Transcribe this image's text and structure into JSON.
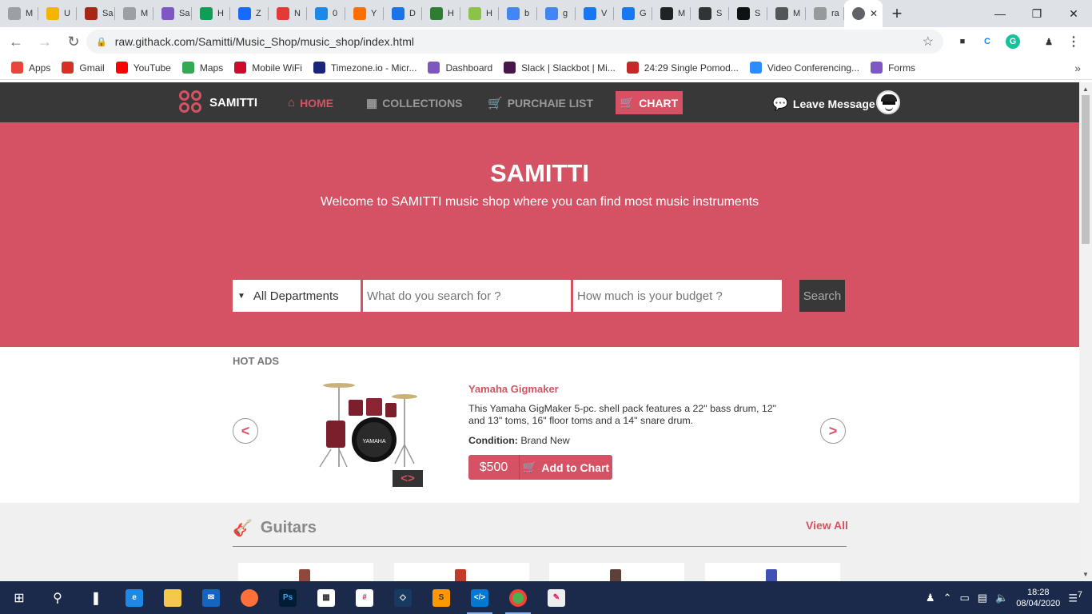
{
  "browser": {
    "tabs": [
      {
        "label": "M",
        "color": "#9aa0a6"
      },
      {
        "label": "U",
        "color": "#f4b400"
      },
      {
        "label": "Sa",
        "color": "#a52714"
      },
      {
        "label": "M",
        "color": "#9aa0a6"
      },
      {
        "label": "Sa",
        "color": "#7e57c2"
      },
      {
        "label": "H",
        "color": "#0f9d58"
      },
      {
        "label": "Z",
        "color": "#1769ff"
      },
      {
        "label": "N",
        "color": "#e53935"
      },
      {
        "label": "0",
        "color": "#1e88e5"
      },
      {
        "label": "Y",
        "color": "#ff6f00"
      },
      {
        "label": "D",
        "color": "#1a73e8"
      },
      {
        "label": "H",
        "color": "#2e7d32"
      },
      {
        "label": "H",
        "color": "#8bc34a"
      },
      {
        "label": "b",
        "color": "#4285f4"
      },
      {
        "label": "g",
        "color": "#4285f4"
      },
      {
        "label": "V",
        "color": "#1877f2"
      },
      {
        "label": "G",
        "color": "#1877f2"
      },
      {
        "label": "M",
        "color": "#222222"
      },
      {
        "label": "S",
        "color": "#333333"
      },
      {
        "label": "S",
        "color": "#111111"
      },
      {
        "label": "M",
        "color": "#555555"
      },
      {
        "label": "ra",
        "color": "#999999"
      }
    ],
    "url": "raw.githack.com/Samitti/Music_Shop/music_shop/index.html",
    "bookmarks": [
      {
        "label": "Apps",
        "icon": "apps-grid-icon",
        "color": "#e8453c"
      },
      {
        "label": "Gmail",
        "icon": "gmail-icon",
        "color": "#d93025"
      },
      {
        "label": "YouTube",
        "icon": "youtube-icon",
        "color": "#ff0000"
      },
      {
        "label": "Maps",
        "icon": "maps-icon",
        "color": "#34a853"
      },
      {
        "label": "Mobile WiFi",
        "icon": "huawei-icon",
        "color": "#cf0a2c"
      },
      {
        "label": "Timezone.io - Micr...",
        "icon": "clock-icon",
        "color": "#1a237e"
      },
      {
        "label": "Dashboard",
        "icon": "dashboard-icon",
        "color": "#7e57c2"
      },
      {
        "label": "Slack | Slackbot | Mi...",
        "icon": "slack-icon",
        "color": "#4a154b"
      },
      {
        "label": "24:29 Single Pomod...",
        "icon": "tomato-icon",
        "color": "#c62828"
      },
      {
        "label": "Video Conferencing...",
        "icon": "zoom-icon",
        "color": "#2d8cff"
      },
      {
        "label": "Forms",
        "icon": "forms-icon",
        "color": "#7e57c2"
      }
    ]
  },
  "site": {
    "brand": "SAMITTI",
    "accent": "#d45263",
    "dark": "#383838",
    "nav": [
      {
        "label": "HOME",
        "icon": "home-icon",
        "active": true
      },
      {
        "label": "COLLECTIONS",
        "icon": "grid-icon",
        "active": false
      },
      {
        "label": "PURCHAIE LIST",
        "icon": "cart-icon",
        "active": false
      }
    ],
    "chart_label": "CHART",
    "leave_message": "Leave Message",
    "hero": {
      "title": "SAMITTI",
      "subtitle": "Welcome to SAMITTI music shop where you can find most music instruments"
    },
    "search": {
      "department": "All Departments",
      "query_placeholder": "What do you search for ?",
      "budget_placeholder": "How much is your budget ?",
      "button": "Search"
    },
    "hot_ads": {
      "label": "HOT ADS",
      "prev": "<",
      "next": ">",
      "swap_badge": "<>",
      "product": {
        "title": "Yamaha Gigmaker",
        "description": "This Yamaha GigMaker 5-pc. shell pack features a 22\" bass drum, 12\" and 13\" toms, 16\" floor toms and a 14\" snare drum.",
        "condition_label": "Condition:",
        "condition": "Brand New",
        "price": "$500",
        "add_label": "Add to Chart"
      }
    },
    "guitars": {
      "title": "Guitars",
      "view_all": "View All",
      "cards": [
        {
          "color": "#8d4a3a"
        },
        {
          "color": "#c0392b"
        },
        {
          "color": "#5d4037"
        },
        {
          "color": "#3f51b5"
        }
      ]
    }
  },
  "taskbar": {
    "time": "18:28",
    "date": "08/04/2020",
    "notifications": "7"
  }
}
